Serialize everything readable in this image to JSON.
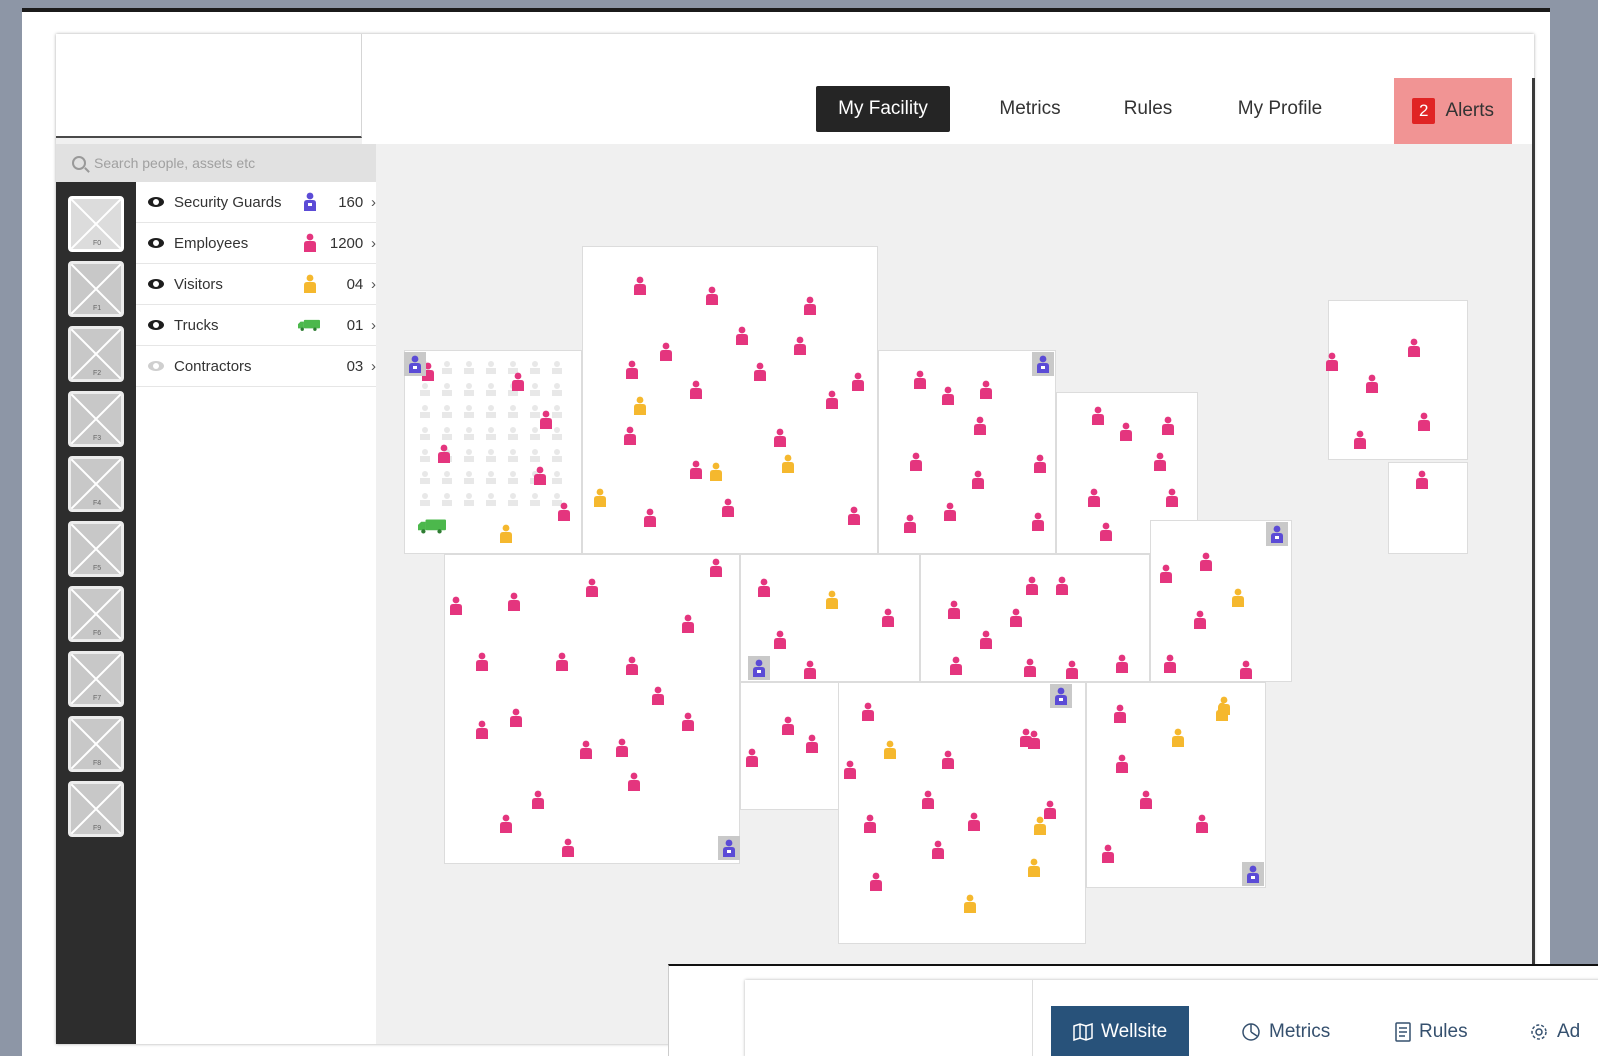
{
  "nav": {
    "tabs": [
      {
        "label": "My Facility",
        "active": true
      },
      {
        "label": "Metrics"
      },
      {
        "label": "Rules"
      },
      {
        "label": "My Profile"
      }
    ],
    "alerts": {
      "count": "2",
      "label": "Alerts"
    }
  },
  "search": {
    "placeholder": "Search people, assets etc"
  },
  "floors": [
    "F0",
    "F1",
    "F2",
    "F3",
    "F4",
    "F5",
    "F6",
    "F7",
    "F8",
    "F9"
  ],
  "legend": [
    {
      "label": "Security Guards",
      "count": "160",
      "icon": "guard-icon",
      "visible": true
    },
    {
      "label": "Employees",
      "count": "1200",
      "icon": "employee-icon",
      "visible": true
    },
    {
      "label": "Visitors",
      "count": "04",
      "icon": "visitor-icon",
      "visible": true
    },
    {
      "label": "Trucks",
      "count": "01",
      "icon": "truck-icon",
      "visible": true
    },
    {
      "label": "Contractors",
      "count": "03",
      "icon": "",
      "visible": false
    }
  ],
  "colors": {
    "employee": "#e4357e",
    "visitor": "#f5b82e",
    "guard": "#5b4bd6",
    "truck": "#4cb84c",
    "alerts_bg": "#f19494",
    "alerts_count": "#e02424"
  },
  "bottom_nav": {
    "tabs": [
      {
        "label": "Wellsite",
        "icon": "map-icon",
        "active": true
      },
      {
        "label": "Metrics",
        "icon": "gauge-icon"
      },
      {
        "label": "Rules",
        "icon": "document-icon"
      },
      {
        "label": "Ad",
        "icon": "gear-icon"
      }
    ]
  }
}
